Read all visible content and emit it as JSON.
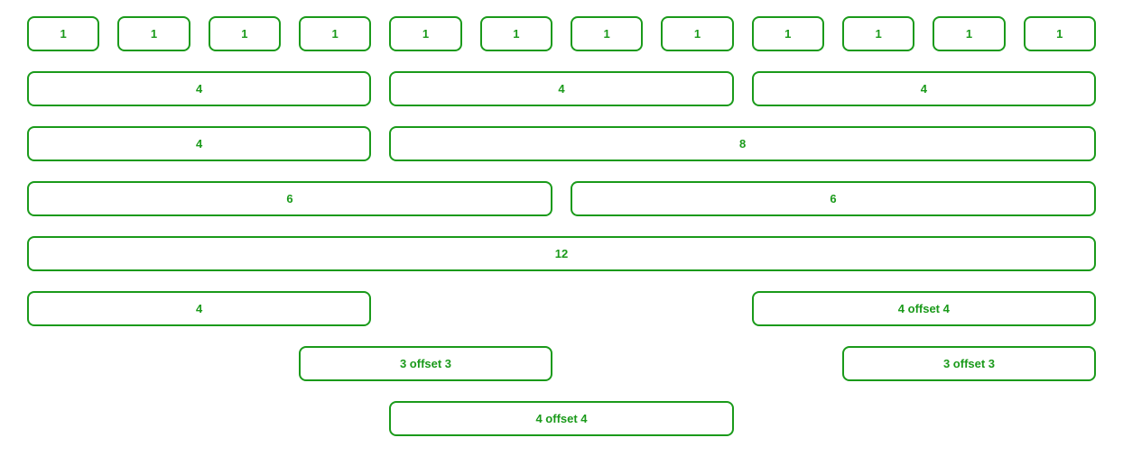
{
  "rows": [
    {
      "cols": [
        {
          "width": 1,
          "offset": 0,
          "label": "1"
        },
        {
          "width": 1,
          "offset": 0,
          "label": "1"
        },
        {
          "width": 1,
          "offset": 0,
          "label": "1"
        },
        {
          "width": 1,
          "offset": 0,
          "label": "1"
        },
        {
          "width": 1,
          "offset": 0,
          "label": "1"
        },
        {
          "width": 1,
          "offset": 0,
          "label": "1"
        },
        {
          "width": 1,
          "offset": 0,
          "label": "1"
        },
        {
          "width": 1,
          "offset": 0,
          "label": "1"
        },
        {
          "width": 1,
          "offset": 0,
          "label": "1"
        },
        {
          "width": 1,
          "offset": 0,
          "label": "1"
        },
        {
          "width": 1,
          "offset": 0,
          "label": "1"
        },
        {
          "width": 1,
          "offset": 0,
          "label": "1"
        }
      ]
    },
    {
      "cols": [
        {
          "width": 4,
          "offset": 0,
          "label": "4"
        },
        {
          "width": 4,
          "offset": 0,
          "label": "4"
        },
        {
          "width": 4,
          "offset": 0,
          "label": "4"
        }
      ]
    },
    {
      "cols": [
        {
          "width": 4,
          "offset": 0,
          "label": "4"
        },
        {
          "width": 8,
          "offset": 0,
          "label": "8"
        }
      ]
    },
    {
      "cols": [
        {
          "width": 6,
          "offset": 0,
          "label": "6"
        },
        {
          "width": 6,
          "offset": 0,
          "label": "6"
        }
      ]
    },
    {
      "cols": [
        {
          "width": 12,
          "offset": 0,
          "label": "12"
        }
      ]
    },
    {
      "cols": [
        {
          "width": 4,
          "offset": 0,
          "label": "4"
        },
        {
          "width": 4,
          "offset": 4,
          "label": "4 offset 4"
        }
      ]
    },
    {
      "cols": [
        {
          "width": 3,
          "offset": 3,
          "label": "3 offset 3"
        },
        {
          "width": 3,
          "offset": 3,
          "label": "3 offset 3"
        }
      ]
    },
    {
      "cols": [
        {
          "width": 4,
          "offset": 4,
          "label": "4 offset 4"
        }
      ]
    }
  ]
}
